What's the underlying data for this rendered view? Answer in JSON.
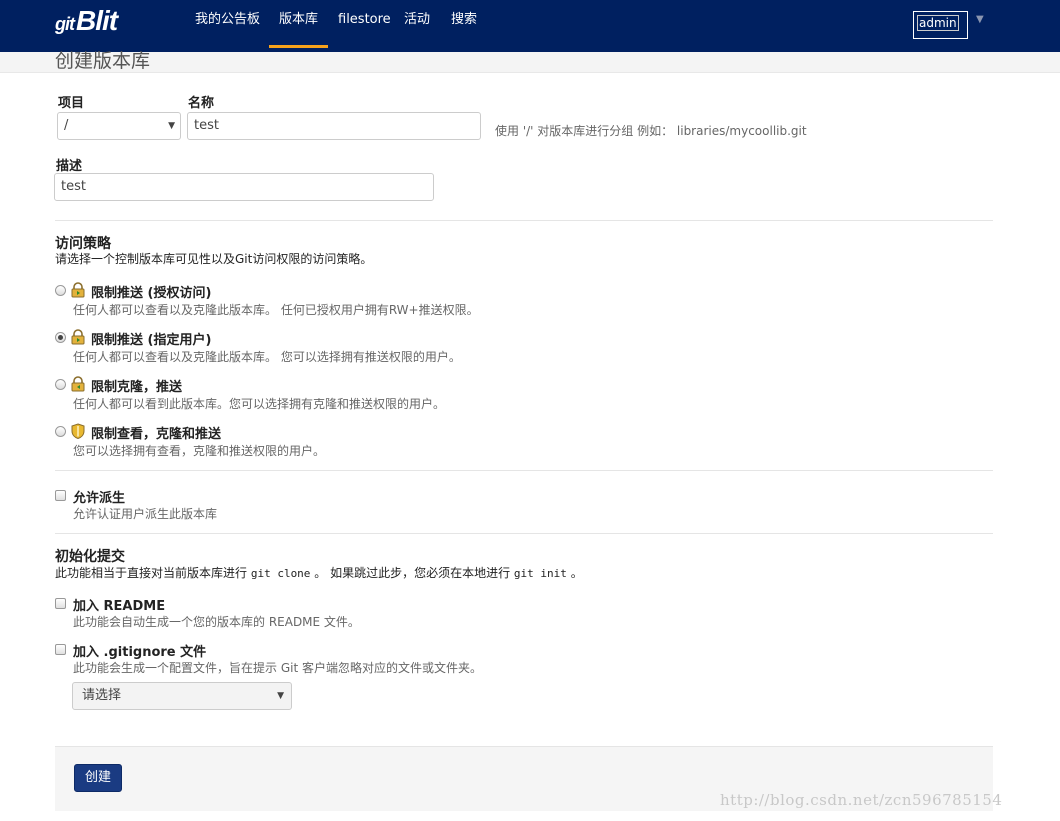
{
  "nav": {
    "brand": "Blit",
    "brand_glyph": "git",
    "items": [
      "我的公告板",
      "版本库",
      "filestore",
      "活动",
      "搜索"
    ],
    "active": "版本库",
    "user": "admin"
  },
  "page_title": "创建版本库",
  "form": {
    "project_label": "项目",
    "project_value": "/",
    "name_label": "名称",
    "name_value": "test",
    "name_hint": "使用 '/' 对版本库进行分组 例如： libraries/mycoollib.git",
    "desc_label": "描述",
    "desc_value": "test"
  },
  "access": {
    "title": "访问策略",
    "desc": "请选择一个控制版本库可见性以及Git访问权限的访问策略。",
    "options": [
      {
        "title": "限制推送 (授权访问)",
        "desc": "任何人都可以查看以及克隆此版本库。 任何已授权用户拥有RW+推送权限。",
        "icon": "lock-push-icon"
      },
      {
        "title": "限制推送 (指定用户)",
        "desc": "任何人都可以查看以及克隆此版本库。  您可以选择拥有推送权限的用户。",
        "icon": "lock-push-icon"
      },
      {
        "title": "限制克隆，推送",
        "desc": "任何人都可以看到此版本库。您可以选择拥有克隆和推送权限的用户。",
        "icon": "lock-clone-icon"
      },
      {
        "title": "限制查看，克隆和推送",
        "desc": "您可以选择拥有查看，克隆和推送权限的用户。",
        "icon": "shield-icon"
      }
    ],
    "selected_index": 1
  },
  "fork": {
    "title": "允许派生",
    "desc": "允许认证用户派生此版本库"
  },
  "init": {
    "title": "初始化提交",
    "desc_pre": "此功能相当于直接对当前版本库进行 ",
    "desc_code1": "git clone",
    "desc_mid": " 。 如果跳过此步，您必须在本地进行 ",
    "desc_code2": "git init",
    "desc_post": " 。",
    "readme_title": "加入 README",
    "readme_desc": "此功能会自动生成一个您的版本库的 README 文件。",
    "gitignore_title": "加入 .gitignore 文件",
    "gitignore_desc": "此功能会生成一个配置文件，旨在提示 Git 客户端忽略对应的文件或文件夹。",
    "gitignore_select": "请选择"
  },
  "create_button": "创建",
  "watermark": "http://blog.csdn.net/zcn596785154",
  "colors": {
    "navbar": "#002060",
    "active_underline": "#f7a21b",
    "button": "#1a3b82"
  }
}
